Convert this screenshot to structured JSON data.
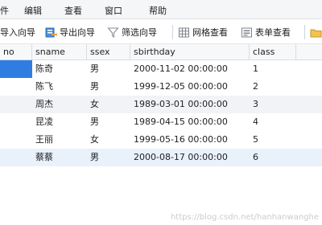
{
  "menu": {
    "items": [
      "件",
      "编辑",
      "查看",
      "窗口",
      "帮助"
    ]
  },
  "toolbar": {
    "import_label": "导入向导",
    "export_label": "导出向导",
    "filter_label": "筛选向导",
    "grid_view_label": "网格查看",
    "form_view_label": "表单查看"
  },
  "grid": {
    "columns": [
      "no",
      "sname",
      "ssex",
      "sbirthday",
      "class"
    ],
    "rows": [
      {
        "no": "",
        "sname": "陈奇",
        "ssex": "男",
        "sbirthday": "2000-11-02 00:00:00",
        "class": "1"
      },
      {
        "no": "",
        "sname": "陈飞",
        "ssex": "男",
        "sbirthday": "1999-12-05 00:00:00",
        "class": "2"
      },
      {
        "no": "",
        "sname": "周杰",
        "ssex": "女",
        "sbirthday": "1989-03-01 00:00:00",
        "class": "3"
      },
      {
        "no": "",
        "sname": "昆凌",
        "ssex": "男",
        "sbirthday": "1989-04-15 00:00:00",
        "class": "4"
      },
      {
        "no": "",
        "sname": "王丽",
        "ssex": "女",
        "sbirthday": "1999-05-16 00:00:00",
        "class": "5"
      },
      {
        "no": "",
        "sname": "蔡蔡",
        "ssex": "男",
        "sbirthday": "2000-08-17 00:00:00",
        "class": "6"
      }
    ]
  },
  "watermark": "https://blog.csdn.net/hanhanwanghe",
  "colors": {
    "selection": "#2f7de1",
    "alt_row": "#f1f3f6",
    "current_row": "#e9f1fb"
  },
  "icons": {
    "import": "import-wizard-icon",
    "export": "export-wizard-icon",
    "filter": "filter-funnel-icon",
    "grid": "grid-view-icon",
    "form": "form-view-icon",
    "folder": "folder-icon"
  }
}
